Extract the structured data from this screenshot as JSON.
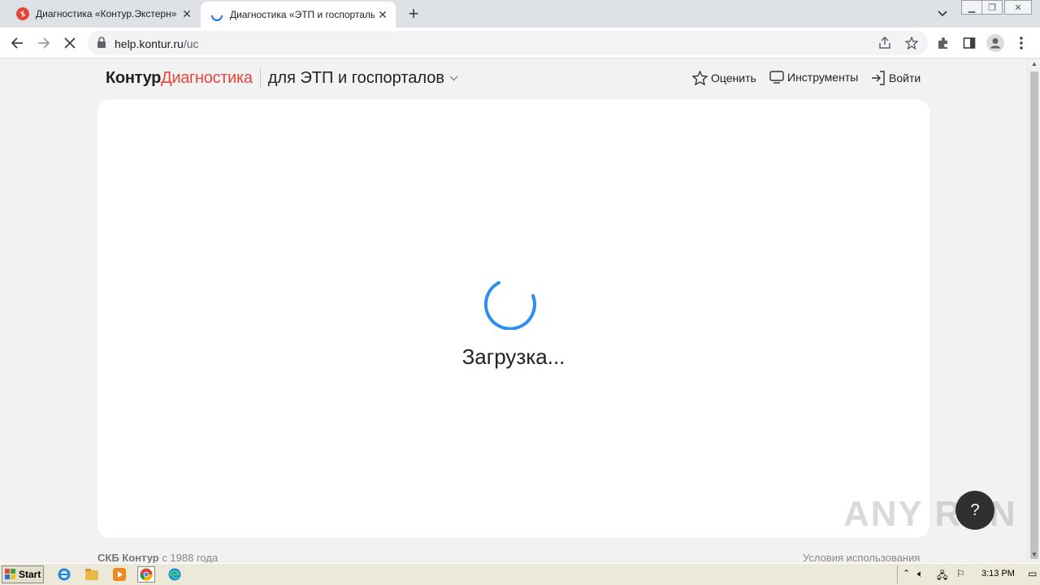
{
  "browser": {
    "tabs": [
      {
        "title": "Диагностика «Контур.Экстерн»"
      },
      {
        "title": "Диагностика «ЭТП и госпорталы»"
      }
    ],
    "url_host": "help.kontur.ru",
    "url_path": "/uc"
  },
  "header": {
    "brand_main": "Контур",
    "brand_accent": "Диагностика",
    "product": "для ЭТП и госпорталов",
    "rate_label": "Оценить",
    "tools_label": "Инструменты",
    "login_label": "Войти"
  },
  "main": {
    "loading_text": "Загрузка..."
  },
  "footer": {
    "company": "СКБ Контур",
    "since": " с 1988 года",
    "terms": "Условия использования"
  },
  "help_button": {
    "label": "?"
  },
  "watermark": "ANY RUN",
  "taskbar": {
    "start_label": "Start",
    "clock": "3:13 PM"
  },
  "colors": {
    "accent": "#e4463a",
    "spinner": "#2c8ef3"
  }
}
